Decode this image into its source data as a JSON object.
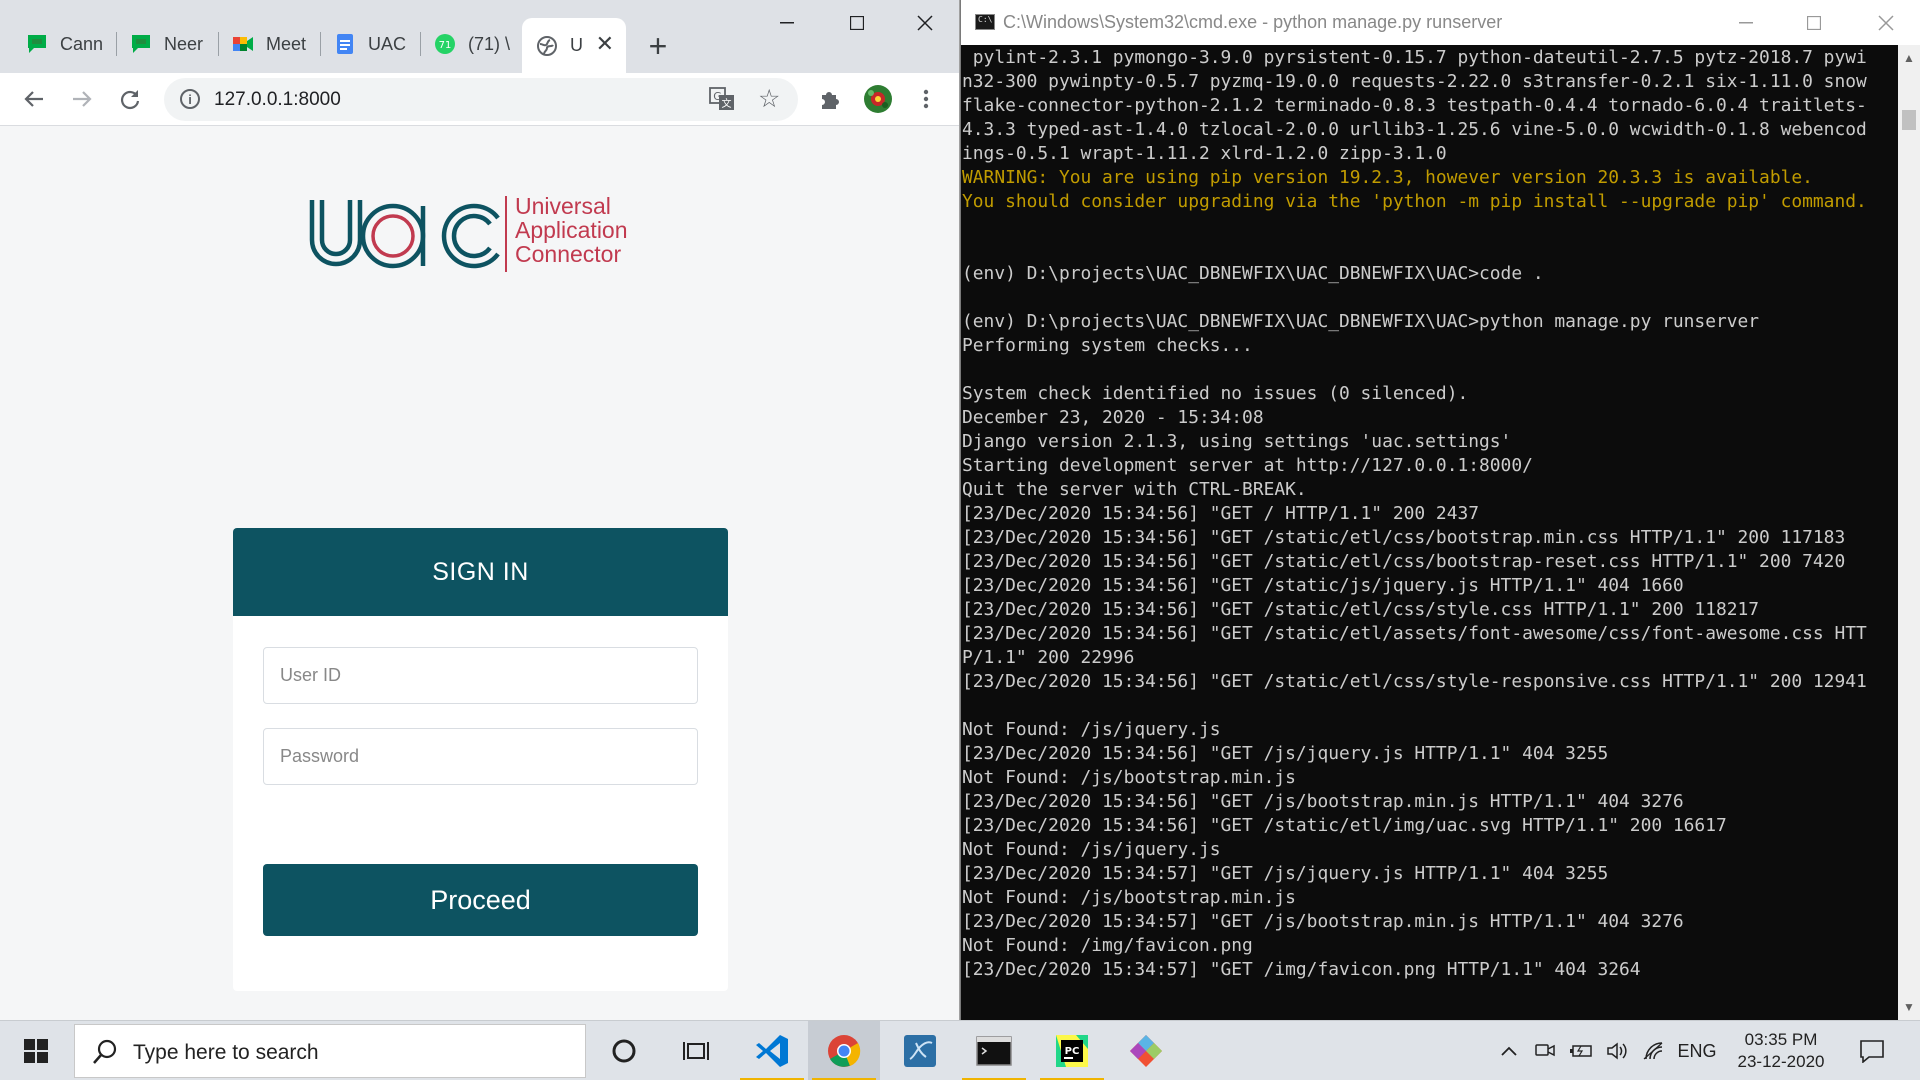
{
  "browser": {
    "tabs": [
      {
        "label": "Cann",
        "icon": "google-chat-icon"
      },
      {
        "label": "Neer",
        "icon": "google-chat-icon"
      },
      {
        "label": "Meet",
        "icon": "google-meet-icon"
      },
      {
        "label": "UAC",
        "icon": "google-docs-icon"
      },
      {
        "label": "(71) \\",
        "icon": "whatsapp-icon"
      },
      {
        "label": "U",
        "icon": "globe-icon",
        "active": true
      }
    ],
    "url": "127.0.0.1:8000"
  },
  "page": {
    "logo_text": "UAC",
    "logo_tagline_lines": [
      "Universal",
      "Application",
      "Connector"
    ],
    "signin_title": "SIGN IN",
    "userid_placeholder": "User ID",
    "password_placeholder": "Password",
    "proceed_label": "Proceed",
    "brand_color": "#0d5361",
    "accent_color": "#c13a4f"
  },
  "terminal": {
    "title": "C:\\Windows\\System32\\cmd.exe - python  manage.py runserver",
    "lines": [
      {
        "text": " pylint-2.3.1 pymongo-3.9.0 pyrsistent-0.15.7 python-dateutil-2.7.5 pytz-2018.7 pywi"
      },
      {
        "text": "n32-300 pywinpty-0.5.7 pyzmq-19.0.0 requests-2.22.0 s3transfer-0.2.1 six-1.11.0 snow"
      },
      {
        "text": "flake-connector-python-2.1.2 terminado-0.8.3 testpath-0.4.4 tornado-6.0.4 traitlets-"
      },
      {
        "text": "4.3.3 typed-ast-1.4.0 tzlocal-2.0.0 urllib3-1.25.6 vine-5.0.0 wcwidth-0.1.8 webencod"
      },
      {
        "text": "ings-0.5.1 wrapt-1.11.2 xlrd-1.2.0 zipp-3.1.0"
      },
      {
        "text": "WARNING: You are using pip version 19.2.3, however version 20.3.3 is available.",
        "warn": true
      },
      {
        "text": "You should consider upgrading via the 'python -m pip install --upgrade pip' command.",
        "warn": true
      },
      {
        "text": ""
      },
      {
        "text": ""
      },
      {
        "text": "(env) D:\\projects\\UAC_DBNEWFIX\\UAC_DBNEWFIX\\UAC>code ."
      },
      {
        "text": ""
      },
      {
        "text": "(env) D:\\projects\\UAC_DBNEWFIX\\UAC_DBNEWFIX\\UAC>python manage.py runserver"
      },
      {
        "text": "Performing system checks..."
      },
      {
        "text": ""
      },
      {
        "text": "System check identified no issues (0 silenced)."
      },
      {
        "text": "December 23, 2020 - 15:34:08"
      },
      {
        "text": "Django version 2.1.3, using settings 'uac.settings'"
      },
      {
        "text": "Starting development server at http://127.0.0.1:8000/"
      },
      {
        "text": "Quit the server with CTRL-BREAK."
      },
      {
        "text": "[23/Dec/2020 15:34:56] \"GET / HTTP/1.1\" 200 2437"
      },
      {
        "text": "[23/Dec/2020 15:34:56] \"GET /static/etl/css/bootstrap.min.css HTTP/1.1\" 200 117183"
      },
      {
        "text": "[23/Dec/2020 15:34:56] \"GET /static/etl/css/bootstrap-reset.css HTTP/1.1\" 200 7420"
      },
      {
        "text": "[23/Dec/2020 15:34:56] \"GET /static/js/jquery.js HTTP/1.1\" 404 1660"
      },
      {
        "text": "[23/Dec/2020 15:34:56] \"GET /static/etl/css/style.css HTTP/1.1\" 200 118217"
      },
      {
        "text": "[23/Dec/2020 15:34:56] \"GET /static/etl/assets/font-awesome/css/font-awesome.css HTT"
      },
      {
        "text": "P/1.1\" 200 22996"
      },
      {
        "text": "[23/Dec/2020 15:34:56] \"GET /static/etl/css/style-responsive.css HTTP/1.1\" 200 12941"
      },
      {
        "text": ""
      },
      {
        "text": "Not Found: /js/jquery.js"
      },
      {
        "text": "[23/Dec/2020 15:34:56] \"GET /js/jquery.js HTTP/1.1\" 404 3255"
      },
      {
        "text": "Not Found: /js/bootstrap.min.js"
      },
      {
        "text": "[23/Dec/2020 15:34:56] \"GET /js/bootstrap.min.js HTTP/1.1\" 404 3276"
      },
      {
        "text": "[23/Dec/2020 15:34:56] \"GET /static/etl/img/uac.svg HTTP/1.1\" 200 16617"
      },
      {
        "text": "Not Found: /js/jquery.js"
      },
      {
        "text": "[23/Dec/2020 15:34:57] \"GET /js/jquery.js HTTP/1.1\" 404 3255"
      },
      {
        "text": "Not Found: /js/bootstrap.min.js"
      },
      {
        "text": "[23/Dec/2020 15:34:57] \"GET /js/bootstrap.min.js HTTP/1.1\" 404 3276"
      },
      {
        "text": "Not Found: /img/favicon.png"
      },
      {
        "text": "[23/Dec/2020 15:34:57] \"GET /img/favicon.png HTTP/1.1\" 404 3264"
      }
    ]
  },
  "taskbar": {
    "search_placeholder": "Type here to search",
    "apps": [
      "cortana-icon",
      "task-view-icon",
      "vscode-icon",
      "chrome-icon",
      "mysql-workbench-icon",
      "cmd-icon",
      "pycharm-icon",
      "git-icon"
    ],
    "language": "ENG",
    "time": "03:35 PM",
    "date": "23-12-2020"
  }
}
